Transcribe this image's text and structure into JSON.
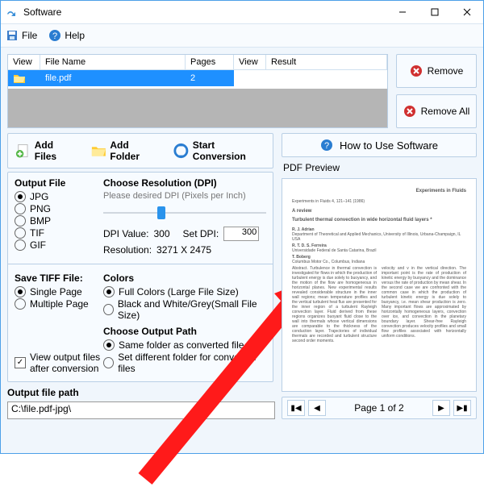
{
  "title": "Software",
  "menu": {
    "file": "File",
    "help": "Help"
  },
  "filelist": {
    "headers": {
      "view1": "View",
      "filename": "File Name",
      "pages": "Pages",
      "view2": "View",
      "result": "Result"
    },
    "rows": [
      {
        "filename": "file.pdf",
        "pages": "2"
      }
    ]
  },
  "buttons": {
    "remove": "Remove",
    "remove_all": "Remove All",
    "add_files": "Add Files",
    "add_folder": "Add Folder",
    "start_conversion": "Start Conversion",
    "how_to_use": "How to Use Software"
  },
  "output_file": {
    "title": "Output File",
    "options": [
      "JPG",
      "PNG",
      "BMP",
      "TIF",
      "GIF"
    ],
    "selected": "JPG"
  },
  "resolution": {
    "title": "Choose Resolution (DPI)",
    "hint": "Please desired DPI (Pixels per Inch)",
    "dpi_value_label": "DPI Value:",
    "dpi_value": "300",
    "set_dpi_label": "Set DPI:",
    "set_dpi_value": "300",
    "resolution_label": "Resolution:",
    "resolution_value": "3271 X 2475"
  },
  "tiff": {
    "title": "Save TIFF File:",
    "options": [
      "Single Page",
      "Multiple Page"
    ],
    "selected": "Single Page"
  },
  "colors": {
    "title": "Colors",
    "full": "Full Colors (Large File Size)",
    "bw": "Black and White/Grey(Small File Size)",
    "selected": "full"
  },
  "out_path_group": {
    "title": "Choose Output Path",
    "same": "Same folder as converted file",
    "diff": "Set different folder for converted files",
    "selected": "same"
  },
  "view_output": {
    "label": "View output files\nafter conversion",
    "checked": true
  },
  "output_file_path": {
    "label": "Output file path",
    "value": "C:\\file.pdf-jpg\\"
  },
  "preview": {
    "label": "PDF Preview",
    "journal": "Experiments in Fluids",
    "article_type": "A review",
    "title": "Turbulent thermal convection in wide horizontal fluid layers *",
    "pager_label": "Page 1 of 2"
  }
}
